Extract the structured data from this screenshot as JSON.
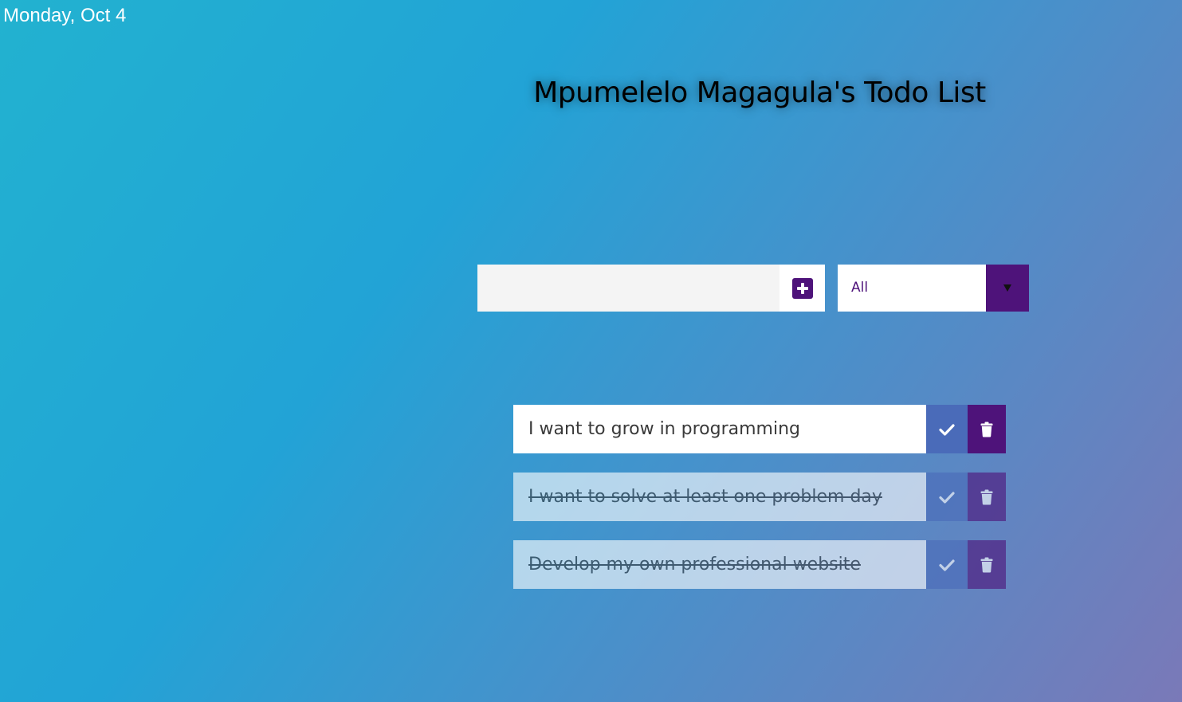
{
  "date": "Monday, Oct 4",
  "title": "Mpumelelo Magagula's Todo List",
  "add_form": {
    "input_value": "",
    "add_icon": "plus-square-icon"
  },
  "filter": {
    "selected": "All",
    "arrow_icon": "caret-down-icon"
  },
  "todos": [
    {
      "text": "I want to grow in programming",
      "completed": false
    },
    {
      "text": "I want to solve at least one problem day",
      "completed": true
    },
    {
      "text": "Develop my own professional website",
      "completed": true
    }
  ],
  "colors": {
    "accent": "#4e137a",
    "check_button": "#4a6bb9",
    "background_start": "#22b2d0",
    "background_end": "#7a79b8"
  }
}
